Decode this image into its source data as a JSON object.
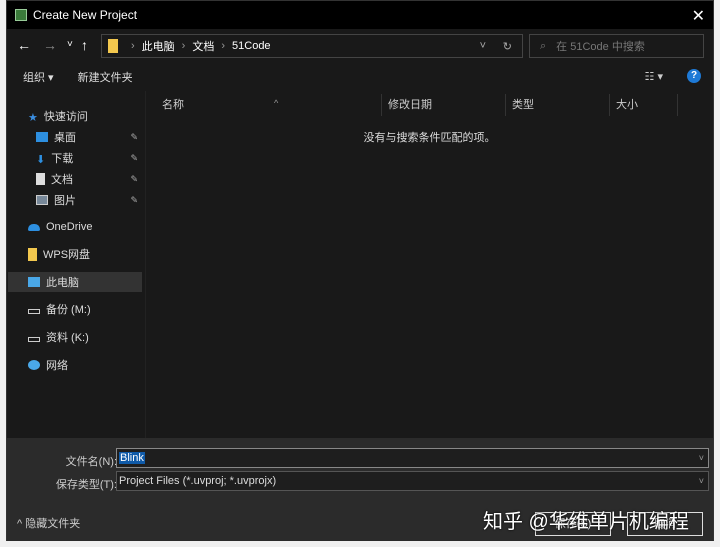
{
  "window": {
    "title": "Create New Project",
    "close": "✕"
  },
  "nav": {
    "back": "←",
    "forward": "→",
    "recent": "˅",
    "up": "↑"
  },
  "address": {
    "crumbs": [
      "此电脑",
      "文档",
      "51Code"
    ],
    "sep": "›",
    "dropdown": "˅",
    "refresh": "↻"
  },
  "search": {
    "icon": "⌕",
    "placeholder": "在 51Code 中搜索"
  },
  "toolbar": {
    "organize": "组织 ▾",
    "new_folder": "新建文件夹",
    "view": "☷ ▾",
    "help": "?"
  },
  "sidebar": {
    "items": [
      {
        "label": "快速访问",
        "icon": "star-icon"
      },
      {
        "label": "桌面",
        "icon": "desktop-icon",
        "pinned": true
      },
      {
        "label": "下载",
        "icon": "download-icon",
        "pinned": true
      },
      {
        "label": "文档",
        "icon": "document-icon",
        "pinned": true
      },
      {
        "label": "图片",
        "icon": "picture-icon",
        "pinned": true
      },
      {
        "label": "OneDrive",
        "icon": "cloud-icon"
      },
      {
        "label": "WPS网盘",
        "icon": "folder-icon"
      },
      {
        "label": "此电脑",
        "icon": "computer-icon",
        "selected": true
      },
      {
        "label": "备份 (M:)",
        "icon": "drive-icon"
      },
      {
        "label": "资料 (K:)",
        "icon": "drive-icon"
      },
      {
        "label": "网络",
        "icon": "network-icon"
      }
    ],
    "pin": "📌"
  },
  "columns": [
    "名称",
    "修改日期",
    "类型",
    "大小"
  ],
  "sort_indicator": "^",
  "empty_message": "没有与搜索条件匹配的项。",
  "form": {
    "filename_label": "文件名(N):",
    "filename_value": "Blink",
    "filetype_label": "保存类型(T):",
    "filetype_value": "Project Files (*.uvproj; *.uvprojx)",
    "chev": "˅"
  },
  "footer": {
    "hide_folders": "^ 隐藏文件夹",
    "save": "保存(S)",
    "cancel": "取消"
  },
  "watermark": "知乎 @华维单片机编程"
}
